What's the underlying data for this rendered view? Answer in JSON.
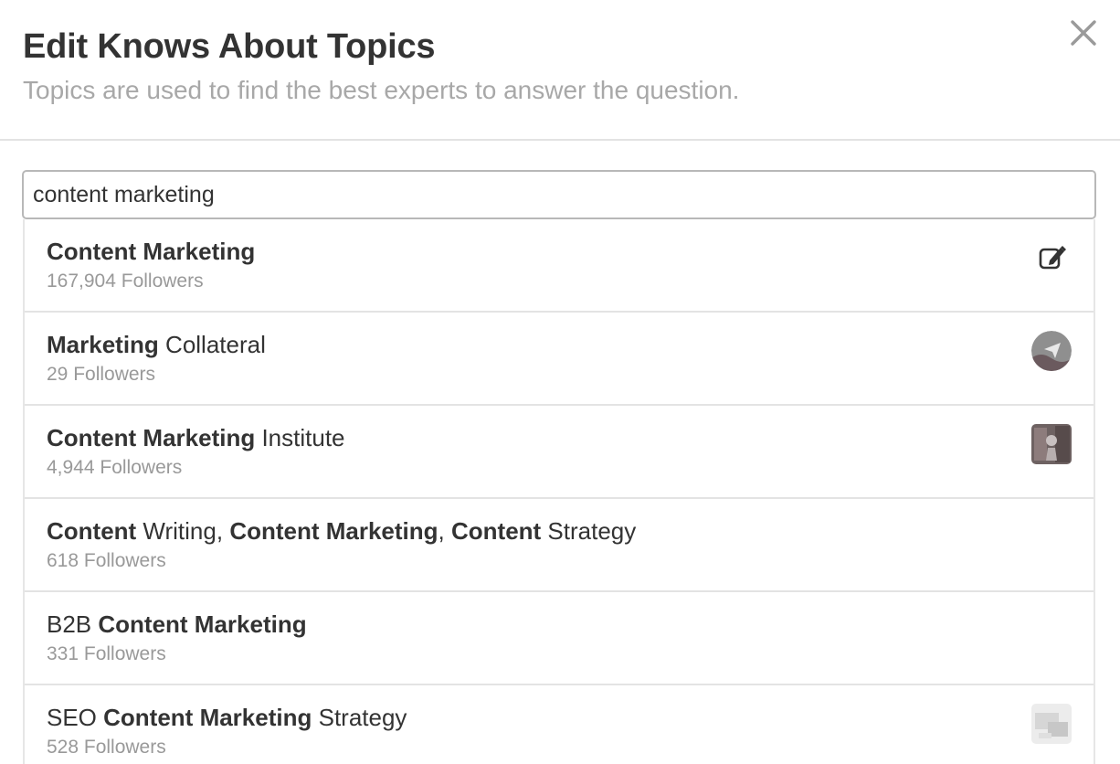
{
  "modal": {
    "title": "Edit Knows About Topics",
    "subtitle": "Topics are used to find the best experts to answer the question.",
    "close_icon": "close-icon"
  },
  "search": {
    "value": "content marketing"
  },
  "results": [
    {
      "segments": [
        {
          "text": "Content Marketing",
          "bold": true
        }
      ],
      "followers": "167,904 Followers",
      "icon": "edit-icon"
    },
    {
      "segments": [
        {
          "text": "Marketing",
          "bold": true
        },
        {
          "text": " Collateral",
          "bold": false
        }
      ],
      "followers": "29 Followers",
      "icon": "topic-thumbnail-round"
    },
    {
      "segments": [
        {
          "text": "Content Marketing",
          "bold": true
        },
        {
          "text": " Institute",
          "bold": false
        }
      ],
      "followers": "4,944 Followers",
      "icon": "topic-thumbnail-photo"
    },
    {
      "segments": [
        {
          "text": "Content",
          "bold": true
        },
        {
          "text": " Writing, ",
          "bold": false
        },
        {
          "text": "Content Marketing",
          "bold": true
        },
        {
          "text": ", ",
          "bold": false
        },
        {
          "text": "Content",
          "bold": true
        },
        {
          "text": " Strategy",
          "bold": false
        }
      ],
      "followers": "618 Followers",
      "icon": ""
    },
    {
      "segments": [
        {
          "text": "B2B ",
          "bold": false
        },
        {
          "text": "Content Marketing",
          "bold": true
        }
      ],
      "followers": "331 Followers",
      "icon": ""
    },
    {
      "segments": [
        {
          "text": "SEO ",
          "bold": false
        },
        {
          "text": "Content Marketing",
          "bold": true
        },
        {
          "text": " Strategy",
          "bold": false
        }
      ],
      "followers": "528 Followers",
      "icon": "topic-thumbnail-light"
    }
  ]
}
